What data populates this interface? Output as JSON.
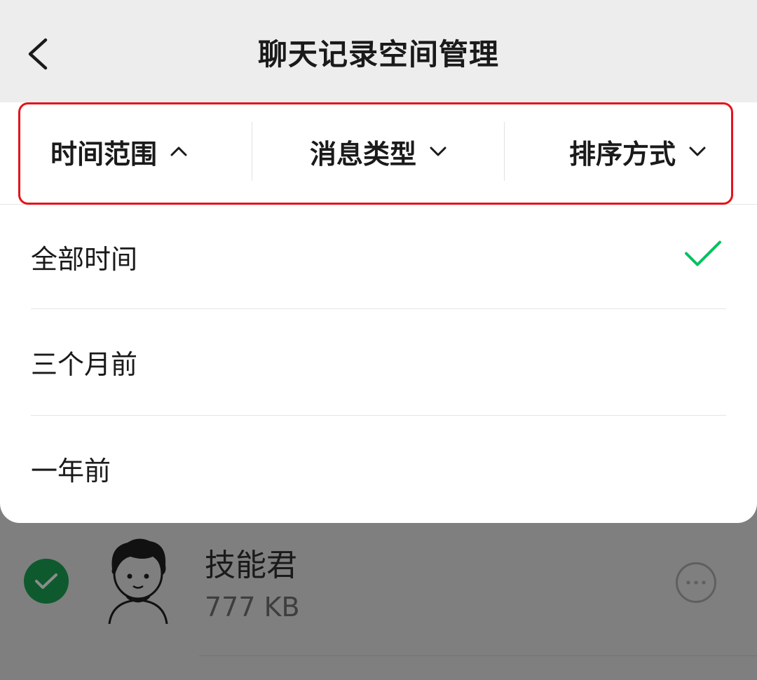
{
  "header": {
    "back_icon": "chevron-left-icon",
    "title": "聊天记录空间管理"
  },
  "filters": [
    {
      "label": "时间范围",
      "icon": "chevron-up-icon",
      "state": "expanded"
    },
    {
      "label": "消息类型",
      "icon": "chevron-down-icon",
      "state": "collapsed"
    },
    {
      "label": "排序方式",
      "icon": "chevron-down-icon",
      "state": "collapsed"
    }
  ],
  "time_options": [
    {
      "label": "全部时间",
      "selected": true
    },
    {
      "label": "三个月前",
      "selected": false
    },
    {
      "label": "一年前",
      "selected": false
    }
  ],
  "colors": {
    "accent_check": "#07c160",
    "highlight_border": "#e3141c",
    "overlay": "#7f7f7f"
  },
  "contact": {
    "name": "技能君",
    "size": "777 KB",
    "selected": true,
    "more_icon": "more-dots-icon"
  }
}
